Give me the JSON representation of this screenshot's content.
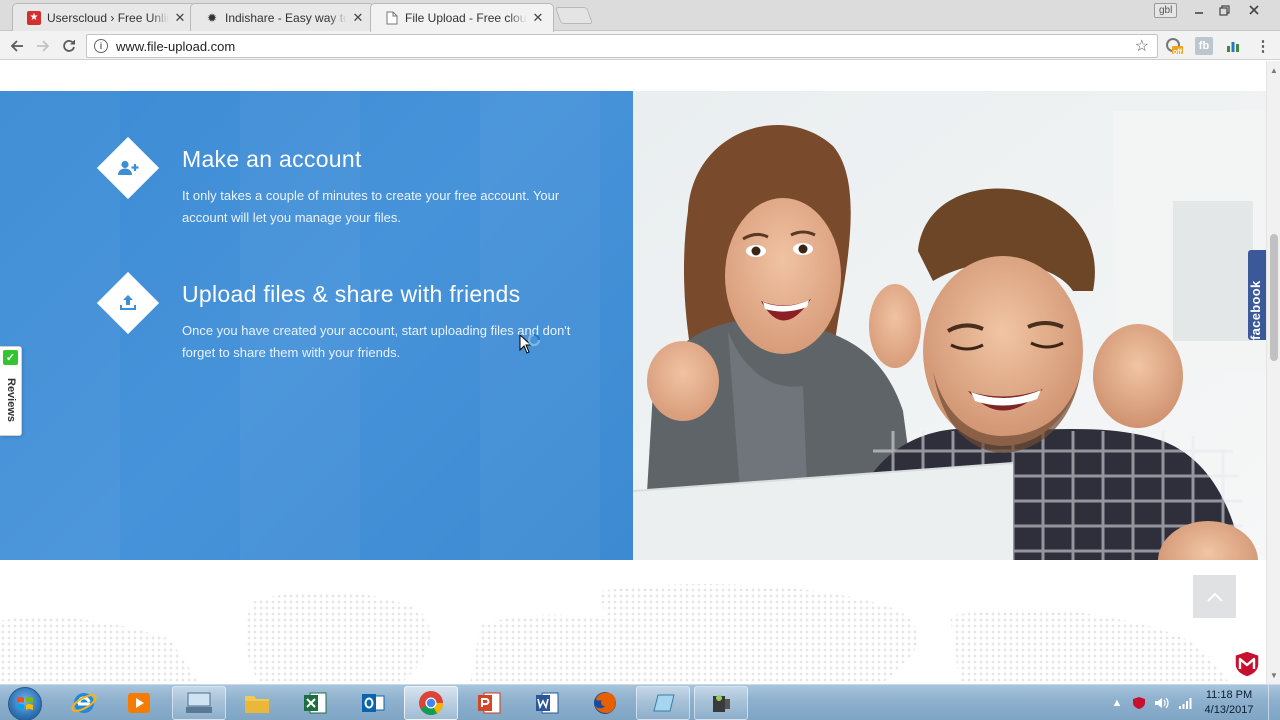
{
  "browser": {
    "tabs": [
      {
        "title": "Userscloud › Free Unlimited",
        "favicon": "userscloud-icon",
        "color": "#d32f2f"
      },
      {
        "title": "Indishare - Easy way to share",
        "favicon": "indishare-icon",
        "color": "#333333"
      },
      {
        "title": "File Upload - Free cloud storage",
        "favicon": "page-icon",
        "color": "#888888"
      }
    ],
    "active_tab": 2,
    "profile": "gbl",
    "url": "www.file-upload.com",
    "extension_badge": "off"
  },
  "page": {
    "features": [
      {
        "icon": "add-user-icon",
        "title": "Make an account",
        "text": "It only takes a couple of minutes to create your free account. Your account will let you manage your files."
      },
      {
        "icon": "upload-icon",
        "title": "Upload files & share with friends",
        "text": "Once you have created your account, start uploading files and don't forget to share them with your friends."
      }
    ],
    "reviews_label": "Reviews",
    "facebook_label": "facebook",
    "colors": {
      "panel_blue": "#4790d8",
      "facebook_blue": "#3b5998",
      "reviews_green": "#33c52f"
    }
  },
  "taskbar": {
    "apps": [
      {
        "name": "internet-explorer-icon",
        "state": "pinned"
      },
      {
        "name": "media-player-icon",
        "state": "pinned"
      },
      {
        "name": "keyboard-app-icon",
        "state": "running"
      },
      {
        "name": "file-explorer-icon",
        "state": "pinned"
      },
      {
        "name": "excel-icon",
        "state": "pinned"
      },
      {
        "name": "outlook-icon",
        "state": "pinned"
      },
      {
        "name": "chrome-icon",
        "state": "active"
      },
      {
        "name": "powerpoint-icon",
        "state": "pinned"
      },
      {
        "name": "word-icon",
        "state": "pinned"
      },
      {
        "name": "firefox-icon",
        "state": "pinned"
      },
      {
        "name": "notes-app-icon",
        "state": "running"
      },
      {
        "name": "video-app-icon",
        "state": "running"
      }
    ],
    "time": "11:18 PM",
    "date": "4/13/2017"
  }
}
